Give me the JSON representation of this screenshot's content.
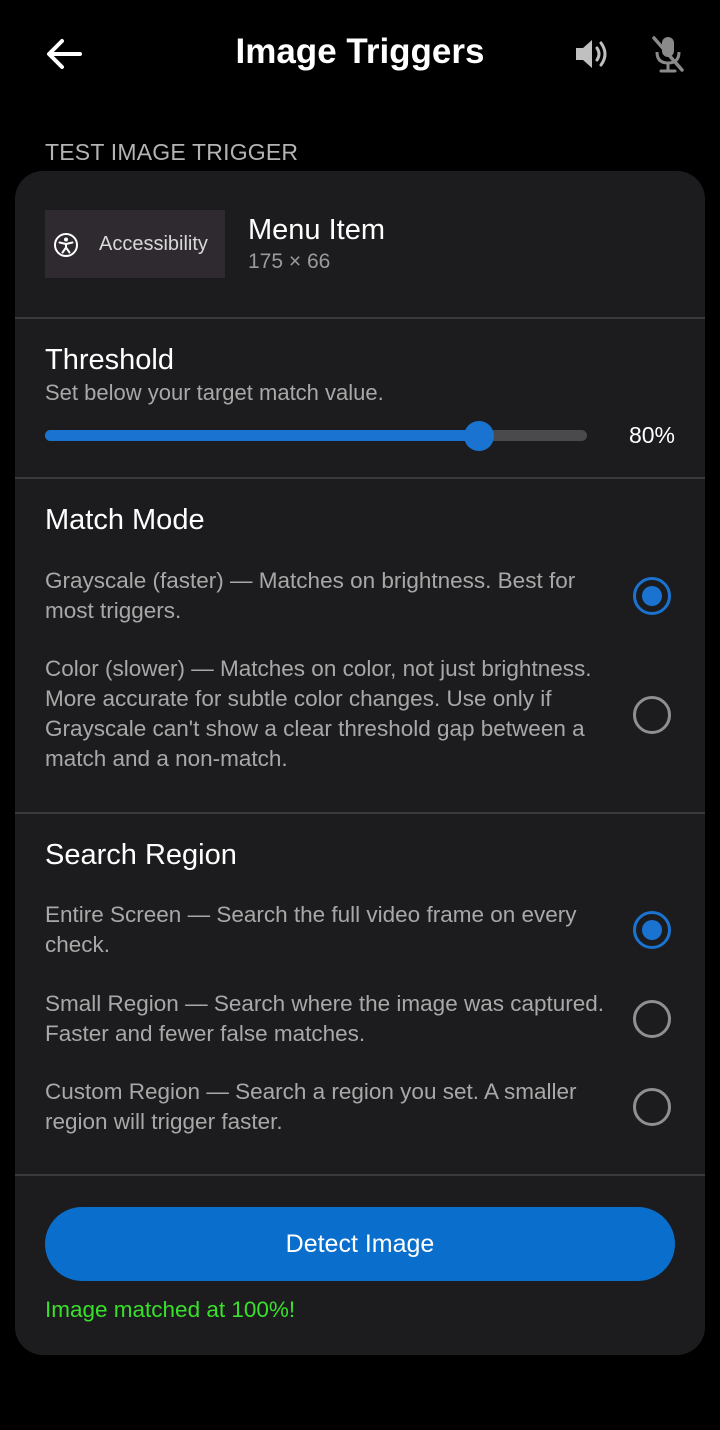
{
  "header": {
    "title": "Image Triggers",
    "back_icon": "arrow-left-icon",
    "speaker_icon": "speaker-icon",
    "mic_icon": "mic-off-icon"
  },
  "section": {
    "header": "TEST IMAGE TRIGGER"
  },
  "image_item": {
    "thumbnail_label": "Accessibility",
    "thumbnail_icon": "accessibility-icon",
    "name": "Menu Item",
    "size": "175 × 66"
  },
  "threshold": {
    "title": "Threshold",
    "subtitle": "Set below your target match value.",
    "value": 80,
    "value_label": "80%"
  },
  "match_mode": {
    "title": "Match Mode",
    "options": [
      {
        "label": "Grayscale (faster) — Matches on brightness. Best for most triggers.",
        "selected": true
      },
      {
        "label": "Color (slower) — Matches on color, not just brightness. More accurate for subtle color changes. Use only if Grayscale can't show a clear threshold gap between a match and a non-match.",
        "selected": false
      }
    ]
  },
  "search_region": {
    "title": "Search Region",
    "options": [
      {
        "label": "Entire Screen — Search the full video frame on every check.",
        "selected": true
      },
      {
        "label": "Small Region — Search where the image was captured. Faster and fewer false matches.",
        "selected": false
      },
      {
        "label": "Custom Region — Search a region you set. A smaller region will trigger faster.",
        "selected": false
      }
    ]
  },
  "detect": {
    "button_label": "Detect Image",
    "result": "Image matched at 100%!"
  },
  "colors": {
    "background": "#000000",
    "card": "#1c1c1e",
    "accent": "#1a73d1",
    "success": "#39e02b"
  }
}
